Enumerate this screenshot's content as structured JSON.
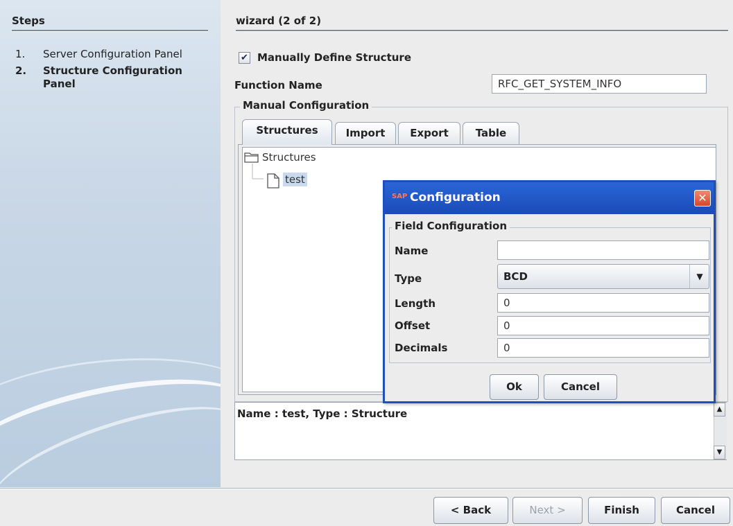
{
  "steps_panel": {
    "title": "Steps",
    "items": [
      {
        "number": "1.",
        "label": "Server Configuration Panel",
        "current": false
      },
      {
        "number": "2.",
        "label": "Structure Configuration Panel",
        "current": true
      }
    ]
  },
  "wizard": {
    "title": "wizard (2 of 2)",
    "manual_define_label": "Manually Define Structure",
    "manual_define_checked": true,
    "function_name_label": "Function Name",
    "function_name_value": "RFC_GET_SYSTEM_INFO",
    "manual_config_label": "Manual Configuration",
    "tabs": [
      {
        "label": "Structures",
        "selected": true
      },
      {
        "label": "Import",
        "selected": false
      },
      {
        "label": "Export",
        "selected": false
      },
      {
        "label": "Table",
        "selected": false
      }
    ],
    "tree": {
      "root_label": "Structures",
      "child_label": "test"
    },
    "description": "Name : test, Type : Structure"
  },
  "buttons": {
    "back": "< Back",
    "next": "Next >",
    "finish": "Finish",
    "cancel": "Cancel"
  },
  "dialog": {
    "logo_text": "SAP",
    "title": "Configuration",
    "close_glyph": "✕",
    "group_label": "Field Configuration",
    "fields": {
      "name_label": "Name",
      "name_value": "",
      "type_label": "Type",
      "type_value": "BCD",
      "length_label": "Length",
      "length_value": "0",
      "offset_label": "Offset",
      "offset_value": "0",
      "decimals_label": "Decimals",
      "decimals_value": "0"
    },
    "ok_label": "Ok",
    "cancel_label": "Cancel"
  },
  "colors": {
    "dialog_title_bar": "#1f4fbf",
    "dialog_close": "#d6472a",
    "selection": "#c9d9ee"
  }
}
